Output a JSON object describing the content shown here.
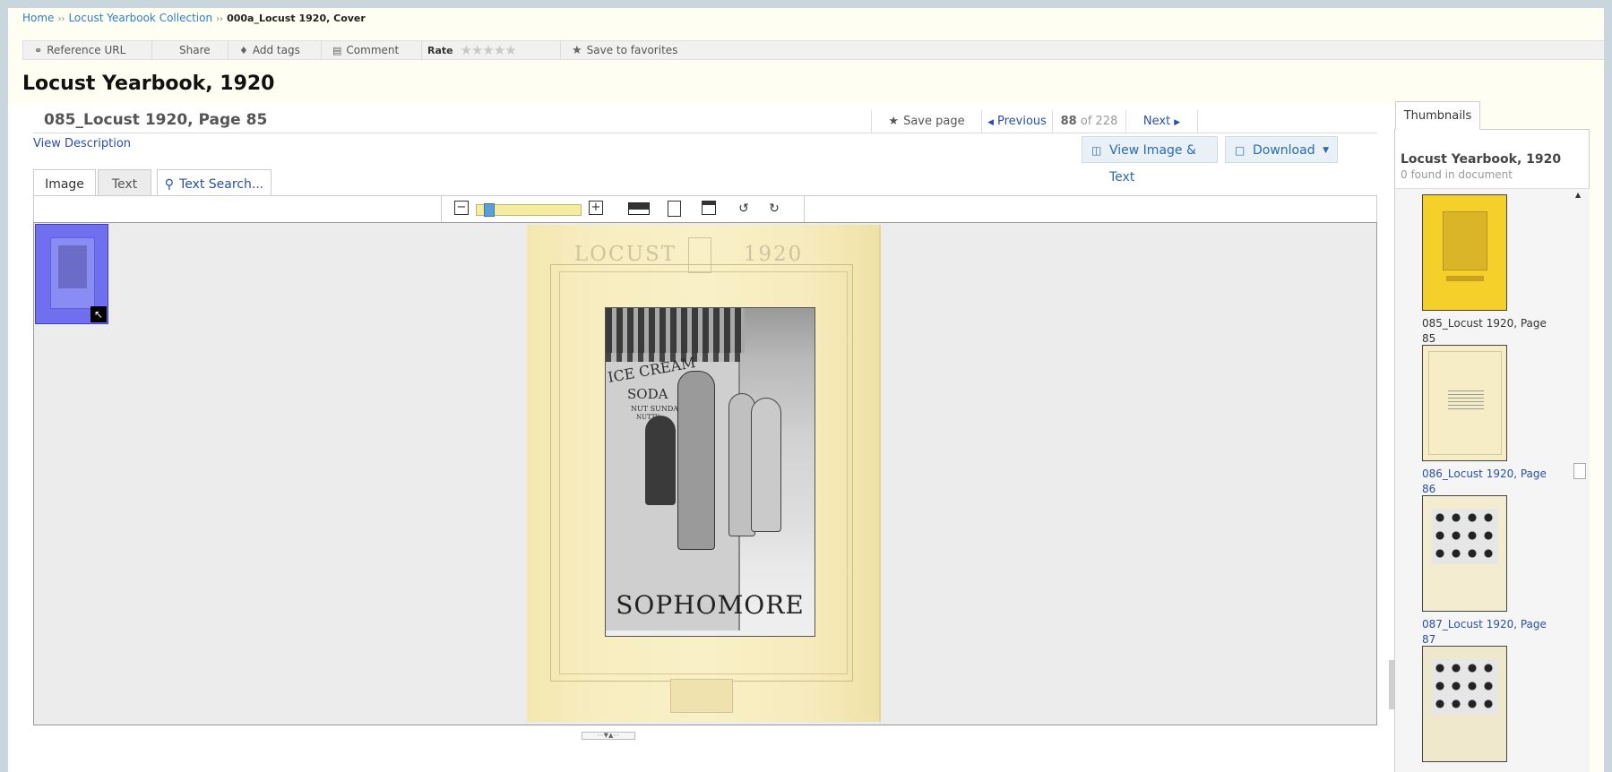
{
  "breadcrumb": {
    "home": "Home",
    "separator": "››",
    "collection": "Locust Yearbook Collection",
    "current": "000a_Locust 1920, Cover"
  },
  "actions": {
    "reference_url": "Reference URL",
    "share": "Share",
    "add_tags": "Add tags",
    "comment": "Comment",
    "rate": "Rate",
    "save_favorites": "Save to favorites"
  },
  "document": {
    "title": "Locust Yearbook, 1920"
  },
  "page": {
    "title": "085_Locust 1920, Page 85",
    "save_page": "Save page",
    "previous": "Previous",
    "current_num": "88",
    "of_text": "of 228",
    "next": "Next",
    "view_description": "View Description",
    "view_image_text": "View Image & Text",
    "download": "Download"
  },
  "tabs": {
    "image": "Image",
    "text": "Text",
    "text_search": "Text Search..."
  },
  "viewer": {
    "zoom_level": 0.08,
    "scan": {
      "banner_left": "LOCUST",
      "banner_right": "1920",
      "sign_line1": "ICE CREAM",
      "sign_line2": "SODA",
      "sign_line3": "NUT SUNDA",
      "sign_line4": "NUTTY",
      "caption": "SOPHOMORE"
    }
  },
  "thumbnails": {
    "tab_label": "Thumbnails",
    "title": "Locust Yearbook, 1920",
    "found": "0 found in document",
    "items": [
      {
        "label": "085_Locust 1920, Page 85",
        "selected": true
      },
      {
        "label": "086_Locust 1920, Page 86",
        "selected": false
      },
      {
        "label": "087_Locust 1920, Page 87",
        "selected": false
      },
      {
        "label": "",
        "selected": false
      }
    ]
  },
  "colors": {
    "link": "#2d7fc4",
    "selected_thumb": "#f5d02a",
    "mini_thumb_highlight": "#6f6ff0"
  },
  "icons": {
    "reference_url": "link-icon",
    "add_tags": "tag-icon",
    "comment": "comment-icon",
    "save_favorites": "star-icon",
    "save_page": "star-icon",
    "previous": "caret-left-icon",
    "next": "caret-right-icon",
    "view_image_text": "view-icon",
    "download": "document-icon",
    "text_search": "magnifier-icon"
  }
}
